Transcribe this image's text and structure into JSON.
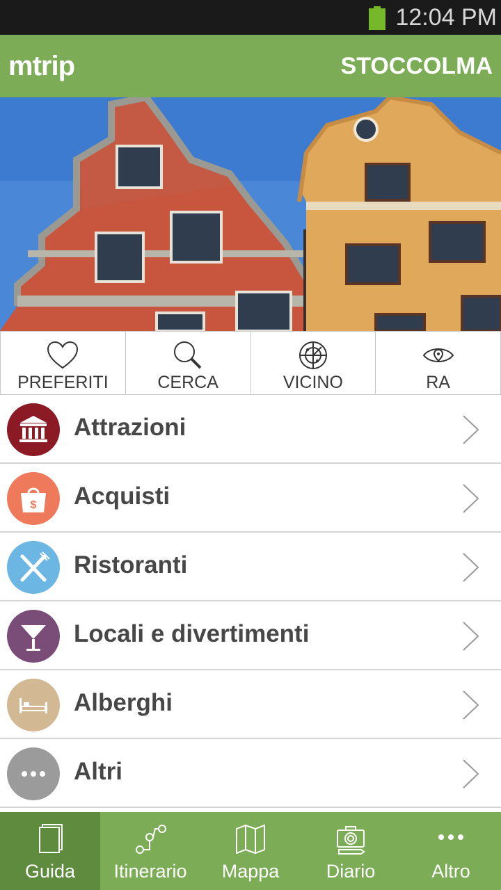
{
  "status_bar": {
    "time": "12:04 PM"
  },
  "header": {
    "logo": "mtrip",
    "city": "STOCCOLMA"
  },
  "quick_actions": [
    {
      "label": "PREFERITI",
      "icon": "heart-icon"
    },
    {
      "label": "CERCA",
      "icon": "search-icon"
    },
    {
      "label": "VICINO",
      "icon": "radar-icon"
    },
    {
      "label": "RA",
      "icon": "eye-icon"
    }
  ],
  "menu": [
    {
      "label": "Attrazioni",
      "icon": "museum-icon",
      "color": "#8b1a24"
    },
    {
      "label": "Acquisti",
      "icon": "shopping-bag-icon",
      "color": "#ee7a5b"
    },
    {
      "label": "Ristoranti",
      "icon": "fork-knife-icon",
      "color": "#6cb6e4"
    },
    {
      "label": "Locali e divertimenti",
      "icon": "cocktail-icon",
      "color": "#7a4c78"
    },
    {
      "label": "Alberghi",
      "icon": "bed-icon",
      "color": "#d3b993"
    },
    {
      "label": "Altri",
      "icon": "more-icon",
      "color": "#9b9b9b"
    }
  ],
  "tabs": [
    {
      "label": "Guida",
      "icon": "book-icon",
      "active": true
    },
    {
      "label": "Itinerario",
      "icon": "route-icon",
      "active": false
    },
    {
      "label": "Mappa",
      "icon": "map-icon",
      "active": false
    },
    {
      "label": "Diario",
      "icon": "camera-icon",
      "active": false
    },
    {
      "label": "Altro",
      "icon": "more-icon",
      "active": false
    }
  ],
  "colors": {
    "brand_green": "#7cad56",
    "active_tab": "#5e8b3d"
  }
}
